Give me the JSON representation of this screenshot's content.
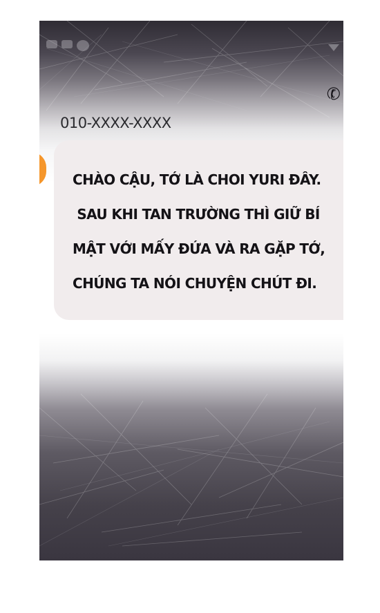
{
  "conversation": {
    "sender_number": "010-XXXX-XXXX",
    "message_lines": [
      "CHÀO CẬU, TỚ LÀ CHOI YURI ĐÂY.",
      " SAU KHI TAN TRƯỜNG THÌ GIỮ BÍ",
      "MẬT VỚI MẤY ĐỨA VÀ RA GẶP TỚ,",
      "CHÚNG TA NÓI CHUYỆN CHÚT ĐI."
    ]
  },
  "icons": {
    "call": "phone-icon",
    "avatar_color": "#f5962b"
  },
  "colors": {
    "bubble": "#f1eced",
    "text": "#141216"
  }
}
